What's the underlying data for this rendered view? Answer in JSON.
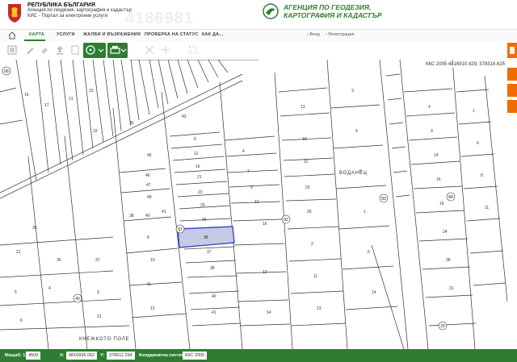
{
  "header": {
    "republic": "РЕПУБЛИКА БЪЛГАРИЯ",
    "subtitle_line1": "Агенция по геодезия, картография и кадастър",
    "subtitle_line2": "КИС - Портал за електронни услуги",
    "watermark": "4186981",
    "agency_line1": "АГЕНЦИЯ ПО ГЕОДЕЗИЯ,",
    "agency_line2": "КАРТОГРАФИЯ И КАДАСТЪР"
  },
  "nav": {
    "items": [
      "КАРТА",
      "УСЛУГИ",
      "ЖАЛБИ И ВЪЗРАЖЕНИЯ",
      "ПРОВЕРКА НА СТАТУС",
      "КАК ДА..."
    ],
    "login": "› Вход",
    "register": "› Регистрация"
  },
  "map": {
    "coords": "ККС 2005 4816910.429, 378316.625",
    "place_labels": [
      "ВОДАНЕЦ",
      "КНЕЖКОТО ПОЛЕ"
    ],
    "circled_labels": [
      "68",
      "81",
      "82",
      "83",
      "84",
      "40",
      "20"
    ],
    "highlighted_parcel": "38",
    "highlight_color": "#3b46c4",
    "highlight_fill": "#c5cbe6"
  },
  "statusbar": {
    "layer_label": "Мащаб: 1:",
    "layer_value": "4509",
    "x_label": "X:",
    "x_value": "4816836.062",
    "y_label": "Y:",
    "y_value": "378611.294",
    "system_label": "Координатна система:",
    "system_value": "ККС 2005"
  }
}
